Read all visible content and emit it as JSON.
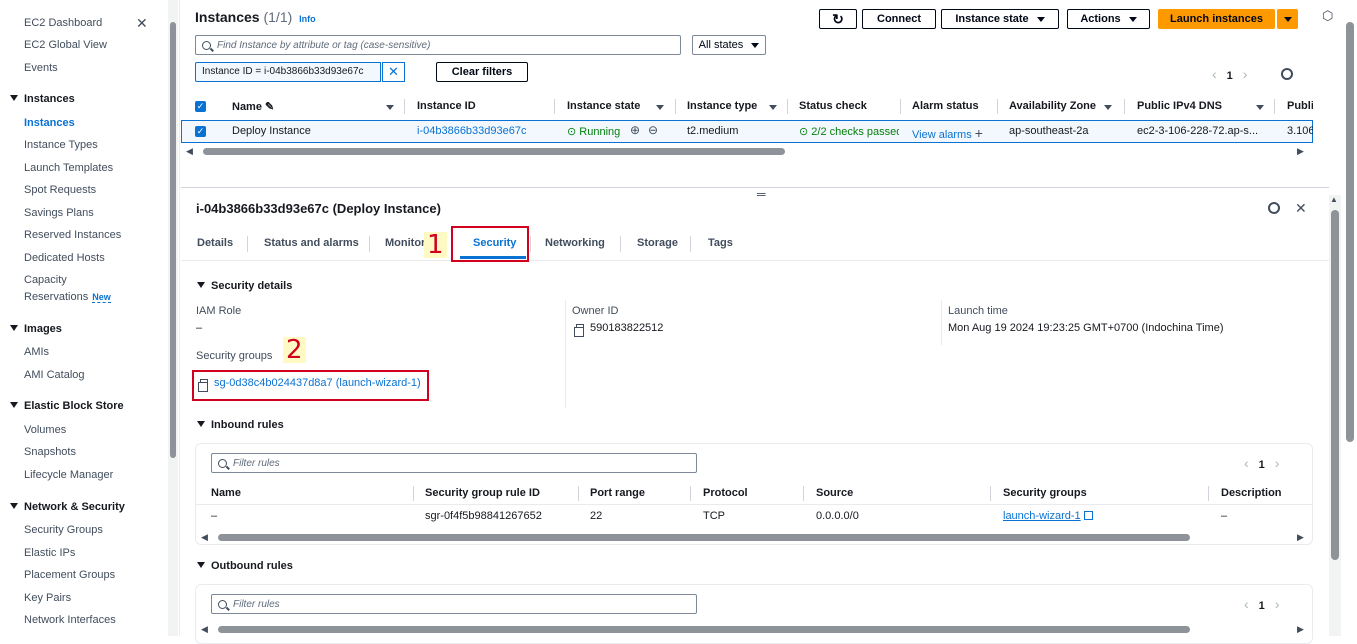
{
  "sidebar": {
    "top_items": [
      "EC2 Dashboard",
      "EC2 Global View",
      "Events"
    ],
    "sections": [
      {
        "title": "Instances",
        "items": [
          "Instances",
          "Instance Types",
          "Launch Templates",
          "Spot Requests",
          "Savings Plans",
          "Reserved Instances",
          "Dedicated Hosts",
          "Capacity",
          "Reservations"
        ]
      },
      {
        "title": "Images",
        "items": [
          "AMIs",
          "AMI Catalog"
        ]
      },
      {
        "title": "Elastic Block Store",
        "items": [
          "Volumes",
          "Snapshots",
          "Lifecycle Manager"
        ]
      },
      {
        "title": "Network & Security",
        "items": [
          "Security Groups",
          "Elastic IPs",
          "Placement Groups",
          "Key Pairs",
          "Network Interfaces"
        ]
      }
    ],
    "new_badge": "New",
    "close": "✕"
  },
  "header": {
    "title": "Instances",
    "count": "(1/1)",
    "info": "Info",
    "connect": "Connect",
    "instance_state": "Instance state",
    "actions": "Actions",
    "launch": "Launch instances"
  },
  "search": {
    "placeholder": "Find Instance by attribute or tag (case-sensitive)",
    "state_filter": "All states",
    "token": "Instance ID = i-04b3866b33d93e67c",
    "clear_filters": "Clear filters",
    "page": "1"
  },
  "table": {
    "columns": [
      "Name",
      "Instance ID",
      "Instance state",
      "Instance type",
      "Status check",
      "Alarm status",
      "Availability Zone",
      "Public IPv4 DNS",
      "Publi"
    ],
    "row": {
      "name": "Deploy Instance",
      "instance_id": "i-04b3866b33d93e67c",
      "state": "Running",
      "type": "t2.medium",
      "status_check": "2/2 checks passed",
      "alarm": "View alarms",
      "az": "ap-southeast-2a",
      "dns": "ec2-3-106-228-72.ap-s...",
      "ip": "3.106"
    }
  },
  "detail": {
    "title": "i-04b3866b33d93e67c (Deploy Instance)",
    "tabs": [
      "Details",
      "Status and alarms",
      "Monitoring",
      "Security",
      "Networking",
      "Storage",
      "Tags"
    ],
    "security_details": "Security details",
    "iam_role_label": "IAM Role",
    "iam_role_value": "–",
    "sg_label": "Security groups",
    "sg_value": "sg-0d38c4b024437d8a7 (launch-wizard-1)",
    "owner_label": "Owner ID",
    "owner_value": "590183822512",
    "launch_label": "Launch time",
    "launch_value": "Mon Aug 19 2024 19:23:25 GMT+0700 (Indochina Time)",
    "inbound_title": "Inbound rules",
    "outbound_title": "Outbound rules",
    "filter_placeholder": "Filter rules",
    "page": "1",
    "rule_columns": [
      "Name",
      "Security group rule ID",
      "Port range",
      "Protocol",
      "Source",
      "Security groups",
      "Description"
    ],
    "rule_row": {
      "name": "–",
      "rule_id": "sgr-0f4f5b98841267652",
      "port": "22",
      "protocol": "TCP",
      "source": "0.0.0.0/0",
      "sg": "launch-wizard-1",
      "description": "–"
    }
  },
  "annotations": {
    "one": "1",
    "two": "2"
  },
  "colors": {
    "accent": "#0972d3",
    "launch": "#ff9900",
    "running": "#037f0c",
    "annotation": "#d1001f"
  }
}
